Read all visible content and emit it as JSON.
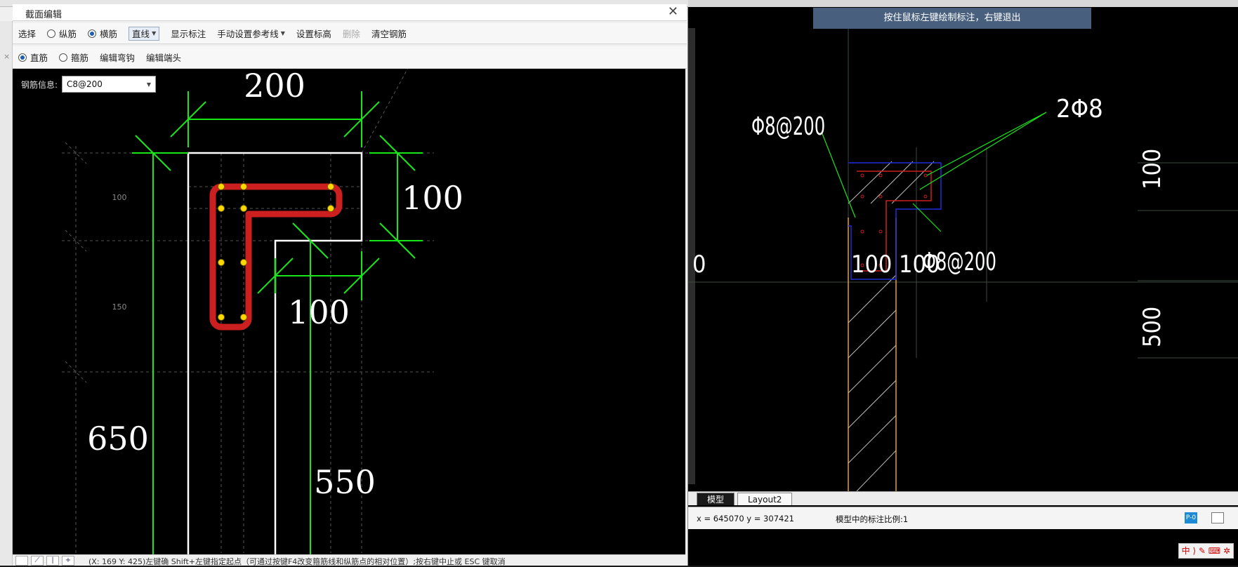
{
  "dialog": {
    "title": "截面编辑",
    "close_icon": "close-icon",
    "side_marker": "×",
    "toolbar1": {
      "select": "选择",
      "longitudinal": "纵筋",
      "transverse": "横筋",
      "line_mode": "直线",
      "show_annotation": "显示标注",
      "manual_ref_line": "手动设置参考线",
      "set_elevation": "设置标高",
      "delete": "删除",
      "clear_rebar": "清空钢筋"
    },
    "toolbar2": {
      "straight_bar": "直筋",
      "stirrup": "箍筋",
      "edit_hook": "编辑弯钩",
      "edit_end": "编辑端头"
    },
    "rebar_info_label": "钢筋信息:",
    "rebar_info_value": "C8@200",
    "status_buttons": [
      "",
      "⟋",
      "|",
      "+"
    ],
    "status_text": "(X: 169 Y: 425)左键确 Shift+左键指定起点（可通过按键F4改变箍筋线和纵筋点的相对位置）;按右键中止或 ESC 键取消"
  },
  "canvas_left": {
    "dims": {
      "top": "200",
      "right_upper": "100",
      "inner_lower": "100",
      "left_total": "650",
      "bottom": "550",
      "grid_upper": "100",
      "grid_lower": "150"
    }
  },
  "cad": {
    "tooltip": "按住鼠标左键绘制标注，右键退出",
    "labels": {
      "stirrup_left": "Φ8@200",
      "top_right": "2Φ8",
      "stirrup_right": "Φ8@200",
      "dim_left_zero": "0",
      "dim_100_a": "100",
      "dim_100_b": "100",
      "dim_right_100": "100",
      "dim_right_500": "500"
    },
    "tabs": {
      "model": "模型",
      "layout2": "Layout2"
    },
    "coords": "x = 645070  y = 307421",
    "scale_text": "模型中的标注比例:1",
    "status_btn": "P-0",
    "ime_text": "中 ⟩ ✎ ⌨ ✲"
  },
  "colors": {
    "rebar_red": "#cc1f1f",
    "dim_green": "#19e619",
    "concrete_outline": "#ffffff",
    "cad_blue": "#1e2dd6",
    "cad_orange": "#e8a21c"
  }
}
